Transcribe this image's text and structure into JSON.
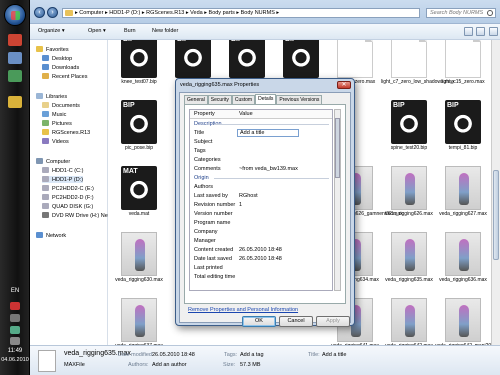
{
  "taskbar": {
    "language": "EN",
    "time": "11:49",
    "date": "04.06.2010"
  },
  "explorer": {
    "address": "▸ Computer ▸ HDD1-P (D:) ▸ RGScenes.R13 ▸ Veda ▸ Body parts ▸ Body NURMS ▸",
    "search_placeholder": "Search Body NURMS",
    "toolbar": {
      "organize": "Organize ▾",
      "open": "Open ▾",
      "burn": "Burn",
      "new_folder": "New folder"
    },
    "nav": {
      "favorites": "Favorites",
      "favorites_items": [
        "Desktop",
        "Downloads",
        "Recent Places"
      ],
      "libraries": "Libraries",
      "libraries_items": [
        "Documents",
        "Music",
        "Pictures",
        "RGScenes.R13",
        "Videos"
      ],
      "computer": "Computer",
      "computer_items": [
        "HDD1-C (C:)",
        "HDD1-P (D:)",
        "PC2HDD2-C (E:)",
        "PC2HDD2-D (F:)",
        "QUAD DISK (G:)",
        "DVD RW Drive (H:) Ne"
      ],
      "network": "Network"
    },
    "files": [
      {
        "name": "knee_test07.bip",
        "kind": "bip",
        "badge": "BIP"
      },
      {
        "name": "leg_test01.bip",
        "kind": "bip",
        "badge": "BIP"
      },
      {
        "name": "legs_test03.bip",
        "kind": "bip",
        "badge": "BIP"
      },
      {
        "name": "legs_up_onspine01.bip",
        "kind": "bip",
        "badge": "BIP"
      },
      {
        "name": "light_c7_zero.max",
        "kind": "blank",
        "badge": ""
      },
      {
        "name": "light_c7_zero_low_shadows.max",
        "kind": "blank",
        "badge": ""
      },
      {
        "name": "light_c15_zero.max",
        "kind": "blank",
        "badge": ""
      },
      {
        "name": "pic_pose.bip",
        "kind": "bip",
        "badge": "BIP"
      },
      {
        "name": "",
        "kind": "none",
        "badge": ""
      },
      {
        "name": "",
        "kind": "none",
        "badge": ""
      },
      {
        "name": "",
        "kind": "none",
        "badge": ""
      },
      {
        "name": "",
        "kind": "none",
        "badge": ""
      },
      {
        "name": "spine_test20.bip",
        "kind": "bip",
        "badge": "BIP"
      },
      {
        "name": "tempi_81.bip",
        "kind": "bip",
        "badge": "BIP"
      },
      {
        "name": "veda.mat",
        "kind": "bip",
        "badge": "MAT"
      },
      {
        "name": "",
        "kind": "none",
        "badge": ""
      },
      {
        "name": "",
        "kind": "none",
        "badge": ""
      },
      {
        "name": "",
        "kind": "none",
        "badge": ""
      },
      {
        "name": "veda_rigging626_gamnent02.max",
        "kind": "render",
        "badge": ""
      },
      {
        "name": "veda_rigging626.max",
        "kind": "render",
        "badge": ""
      },
      {
        "name": "veda_rigging627.max",
        "kind": "render",
        "badge": ""
      },
      {
        "name": "veda_rigging630.max",
        "kind": "render",
        "badge": ""
      },
      {
        "name": "",
        "kind": "none",
        "badge": ""
      },
      {
        "name": "",
        "kind": "none",
        "badge": ""
      },
      {
        "name": "",
        "kind": "none",
        "badge": ""
      },
      {
        "name": "veda_rigging634.max",
        "kind": "render",
        "badge": ""
      },
      {
        "name": "veda_rigging635.max",
        "kind": "render",
        "badge": ""
      },
      {
        "name": "veda_rigging636.max",
        "kind": "render",
        "badge": ""
      },
      {
        "name": "veda_rigging637.max",
        "kind": "render",
        "badge": ""
      },
      {
        "name": "",
        "kind": "none",
        "badge": ""
      },
      {
        "name": "",
        "kind": "none",
        "badge": ""
      },
      {
        "name": "",
        "kind": "none",
        "badge": ""
      },
      {
        "name": "veda_rigging641.max",
        "kind": "render",
        "badge": ""
      },
      {
        "name": "veda_rigging642.max",
        "kind": "render",
        "badge": ""
      },
      {
        "name": "veda_rigging642_mani2018.max",
        "kind": "render",
        "badge": ""
      }
    ],
    "details": {
      "filename": "veda_rigging635.max",
      "filetype": "MAXFile",
      "date_modified_label": "Date modified:",
      "date_modified": "26.05.2010 18:48",
      "authors_label": "Authors:",
      "authors": "Add an author",
      "tags_label": "Tags:",
      "tags": "Add a tag",
      "title_label": "Title:",
      "title": "Add a title",
      "size_label": "Size:",
      "size": "57.3 MB"
    }
  },
  "dialog": {
    "title": "veda_rigging635.max Properties",
    "close": "✕",
    "tabs": [
      "General",
      "Security",
      "Custom",
      "Details",
      "Previous Versions"
    ],
    "active_tab": "Details",
    "col_property": "Property",
    "col_value": "Value",
    "group_description": "Description",
    "title_key": "Title",
    "title_value": "Add a title",
    "description_rows": [
      {
        "k": "Subject",
        "v": ""
      },
      {
        "k": "Tags",
        "v": ""
      },
      {
        "k": "Categories",
        "v": ""
      },
      {
        "k": "Comments",
        "v": "~from veda_bw139.max"
      }
    ],
    "group_origin": "Origin",
    "origin_rows": [
      {
        "k": "Authors",
        "v": ""
      },
      {
        "k": "Last saved by",
        "v": "RGhost"
      },
      {
        "k": "Revision number",
        "v": "1"
      },
      {
        "k": "Version number",
        "v": ""
      },
      {
        "k": "Program name",
        "v": ""
      },
      {
        "k": "Company",
        "v": ""
      },
      {
        "k": "Manager",
        "v": ""
      },
      {
        "k": "Content created",
        "v": "26.05.2010 18:48"
      },
      {
        "k": "Date last saved",
        "v": "26.05.2010 18:48"
      },
      {
        "k": "Last printed",
        "v": ""
      },
      {
        "k": "Total editing time",
        "v": ""
      }
    ],
    "remove_link": "Remove Properties and Personal Information",
    "ok": "OK",
    "cancel": "Cancel",
    "apply": "Apply"
  }
}
